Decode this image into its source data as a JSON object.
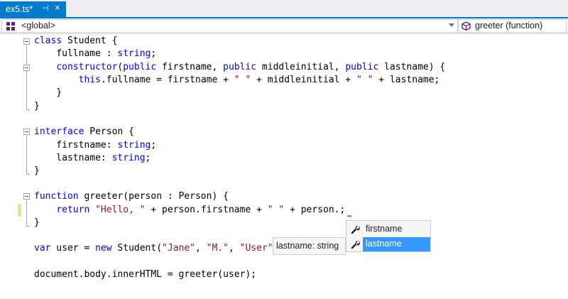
{
  "tab": {
    "title": "ex5.ts*",
    "pin_glyph": "⊣",
    "close_glyph": "×"
  },
  "navbar": {
    "scope": "<global>",
    "member": "greeter (function)",
    "scope_icon": "class-icon",
    "member_icon": "function-cube-icon"
  },
  "code": {
    "lines": [
      [
        {
          "t": "class",
          "c": "kw"
        },
        {
          "t": " Student {"
        }
      ],
      [
        {
          "t": "    fullname : "
        },
        {
          "t": "string",
          "c": "kw"
        },
        {
          "t": ";"
        }
      ],
      [
        {
          "t": "    "
        },
        {
          "t": "constructor",
          "c": "kw"
        },
        {
          "t": "("
        },
        {
          "t": "public",
          "c": "kw"
        },
        {
          "t": " firstname, "
        },
        {
          "t": "public",
          "c": "kw"
        },
        {
          "t": " middleinitial, "
        },
        {
          "t": "public",
          "c": "kw"
        },
        {
          "t": " lastname) {"
        }
      ],
      [
        {
          "t": "        "
        },
        {
          "t": "this",
          "c": "kw"
        },
        {
          "t": ".fullname = firstname + "
        },
        {
          "t": "\" \"",
          "c": "str"
        },
        {
          "t": " + middleinitial + "
        },
        {
          "t": "\" \"",
          "c": "str"
        },
        {
          "t": " + lastname;"
        }
      ],
      [
        {
          "t": "    }"
        }
      ],
      [
        {
          "t": "}"
        }
      ],
      [],
      [
        {
          "t": "interface",
          "c": "kw"
        },
        {
          "t": " Person {"
        }
      ],
      [
        {
          "t": "    firstname: "
        },
        {
          "t": "string",
          "c": "kw"
        },
        {
          "t": ";"
        }
      ],
      [
        {
          "t": "    lastname: "
        },
        {
          "t": "string",
          "c": "kw"
        },
        {
          "t": ";"
        }
      ],
      [
        {
          "t": "}"
        }
      ],
      [],
      [
        {
          "t": "function",
          "c": "kw"
        },
        {
          "t": " greeter(person : Person) {"
        }
      ],
      [
        {
          "t": "    "
        },
        {
          "t": "return",
          "c": "kw"
        },
        {
          "t": " "
        },
        {
          "t": "\"Hello, \"",
          "c": "str"
        },
        {
          "t": " + person.firstname + "
        },
        {
          "t": "\" \"",
          "c": "str"
        },
        {
          "t": " + person.;"
        }
      ],
      [
        {
          "t": "}"
        }
      ],
      [],
      [
        {
          "t": "var",
          "c": "kw"
        },
        {
          "t": " user = "
        },
        {
          "t": "new",
          "c": "kw"
        },
        {
          "t": " Student("
        },
        {
          "t": "\"Jane\"",
          "c": "str"
        },
        {
          "t": ", "
        },
        {
          "t": "\"M.\"",
          "c": "str"
        },
        {
          "t": ", "
        },
        {
          "t": "\"User\"",
          "c": "str"
        },
        {
          "t": ");"
        }
      ],
      [],
      [
        {
          "t": "document.body.innerHTML = greeter(user);"
        }
      ]
    ]
  },
  "tooltip": {
    "text": "lastname: string"
  },
  "completion": {
    "items": [
      {
        "label": "firstname",
        "icon": "wrench-icon",
        "selected": false
      },
      {
        "label": "lastname",
        "icon": "wrench-icon",
        "selected": true
      }
    ]
  },
  "colors": {
    "accent": "#007acc",
    "keyword": "#0000ff",
    "string": "#a31515",
    "selection": "#3399ff",
    "changebar": "#efe38a",
    "error_squiggle": "#e51400"
  }
}
